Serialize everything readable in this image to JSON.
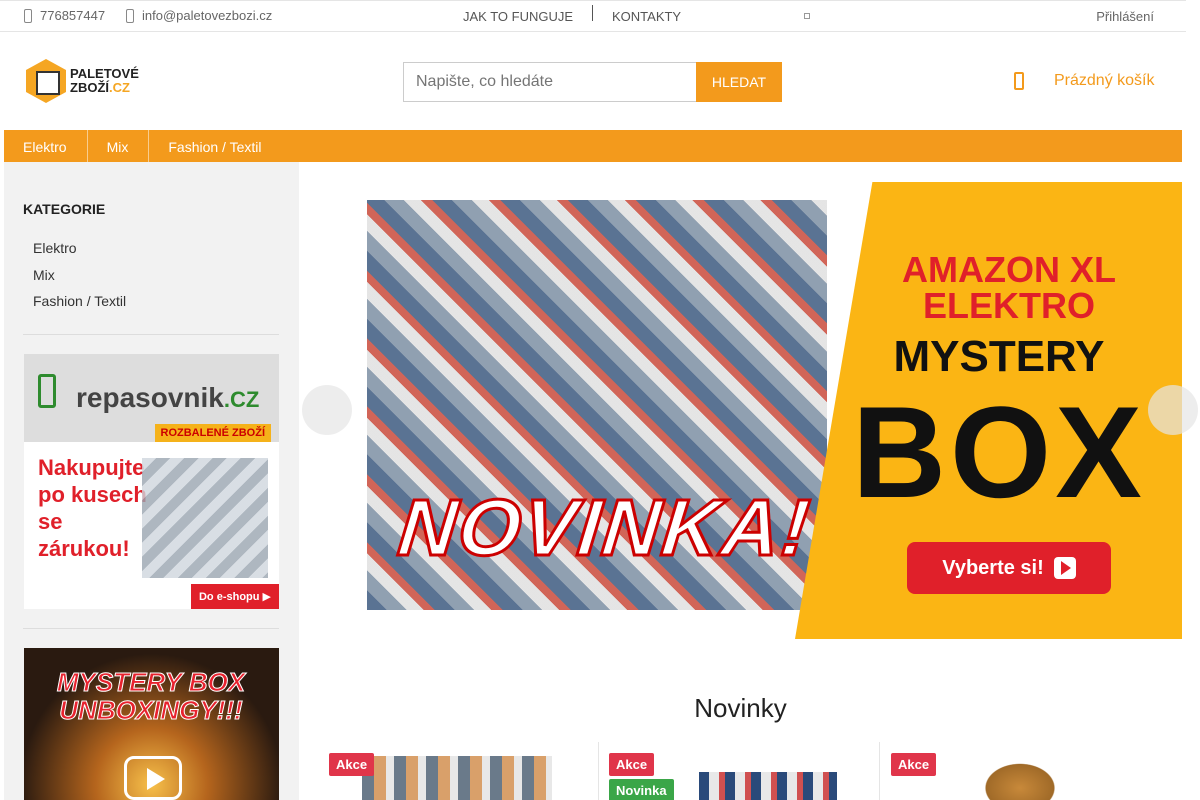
{
  "topbar": {
    "phone": "776857447",
    "email": "info@paletovezbozi.cz",
    "links": [
      "JAK TO FUNGUJE",
      "KONTAKTY"
    ],
    "login": "Přihlášení"
  },
  "header": {
    "logo_line1": "PALETOVÉ",
    "logo_line2": "ZBOŽÍ",
    "logo_tld": ".CZ",
    "search_placeholder": "Napište, co hledáte",
    "search_button": "HLEDAT",
    "cart_label": "Prázdný košík"
  },
  "catnav": [
    "Elektro",
    "Mix",
    "Fashion / Textil"
  ],
  "sidebar": {
    "heading": "KATEGORIE",
    "items": [
      "Elektro",
      "Mix",
      "Fashion / Textil"
    ],
    "banner_repasovnik": {
      "brand": "repasovnik",
      "brand_tld": ".CZ",
      "tag": "ROZBALENÉ ZBOŽÍ",
      "slogan": "Nakupujte po kusech se zárukou!",
      "cta": "Do e-shopu ▶"
    },
    "banner_mystery": {
      "title": "MYSTERY BOX UNBOXINGY!!!"
    }
  },
  "hero": {
    "line1": "AMAZON XL ELEKTRO",
    "line2": "MYSTERY",
    "line3": "BOX",
    "badge": "NOVINKA!",
    "cta": "Vyberte si!"
  },
  "section_title": "Novinky",
  "products": [
    {
      "badges": [
        "Akce"
      ]
    },
    {
      "badges": [
        "Akce",
        "Novinka"
      ]
    },
    {
      "badges": [
        "Akce"
      ]
    }
  ],
  "colors": {
    "accent": "#f39a1c",
    "akce": "#e0354a",
    "novinka": "#3aa648"
  }
}
